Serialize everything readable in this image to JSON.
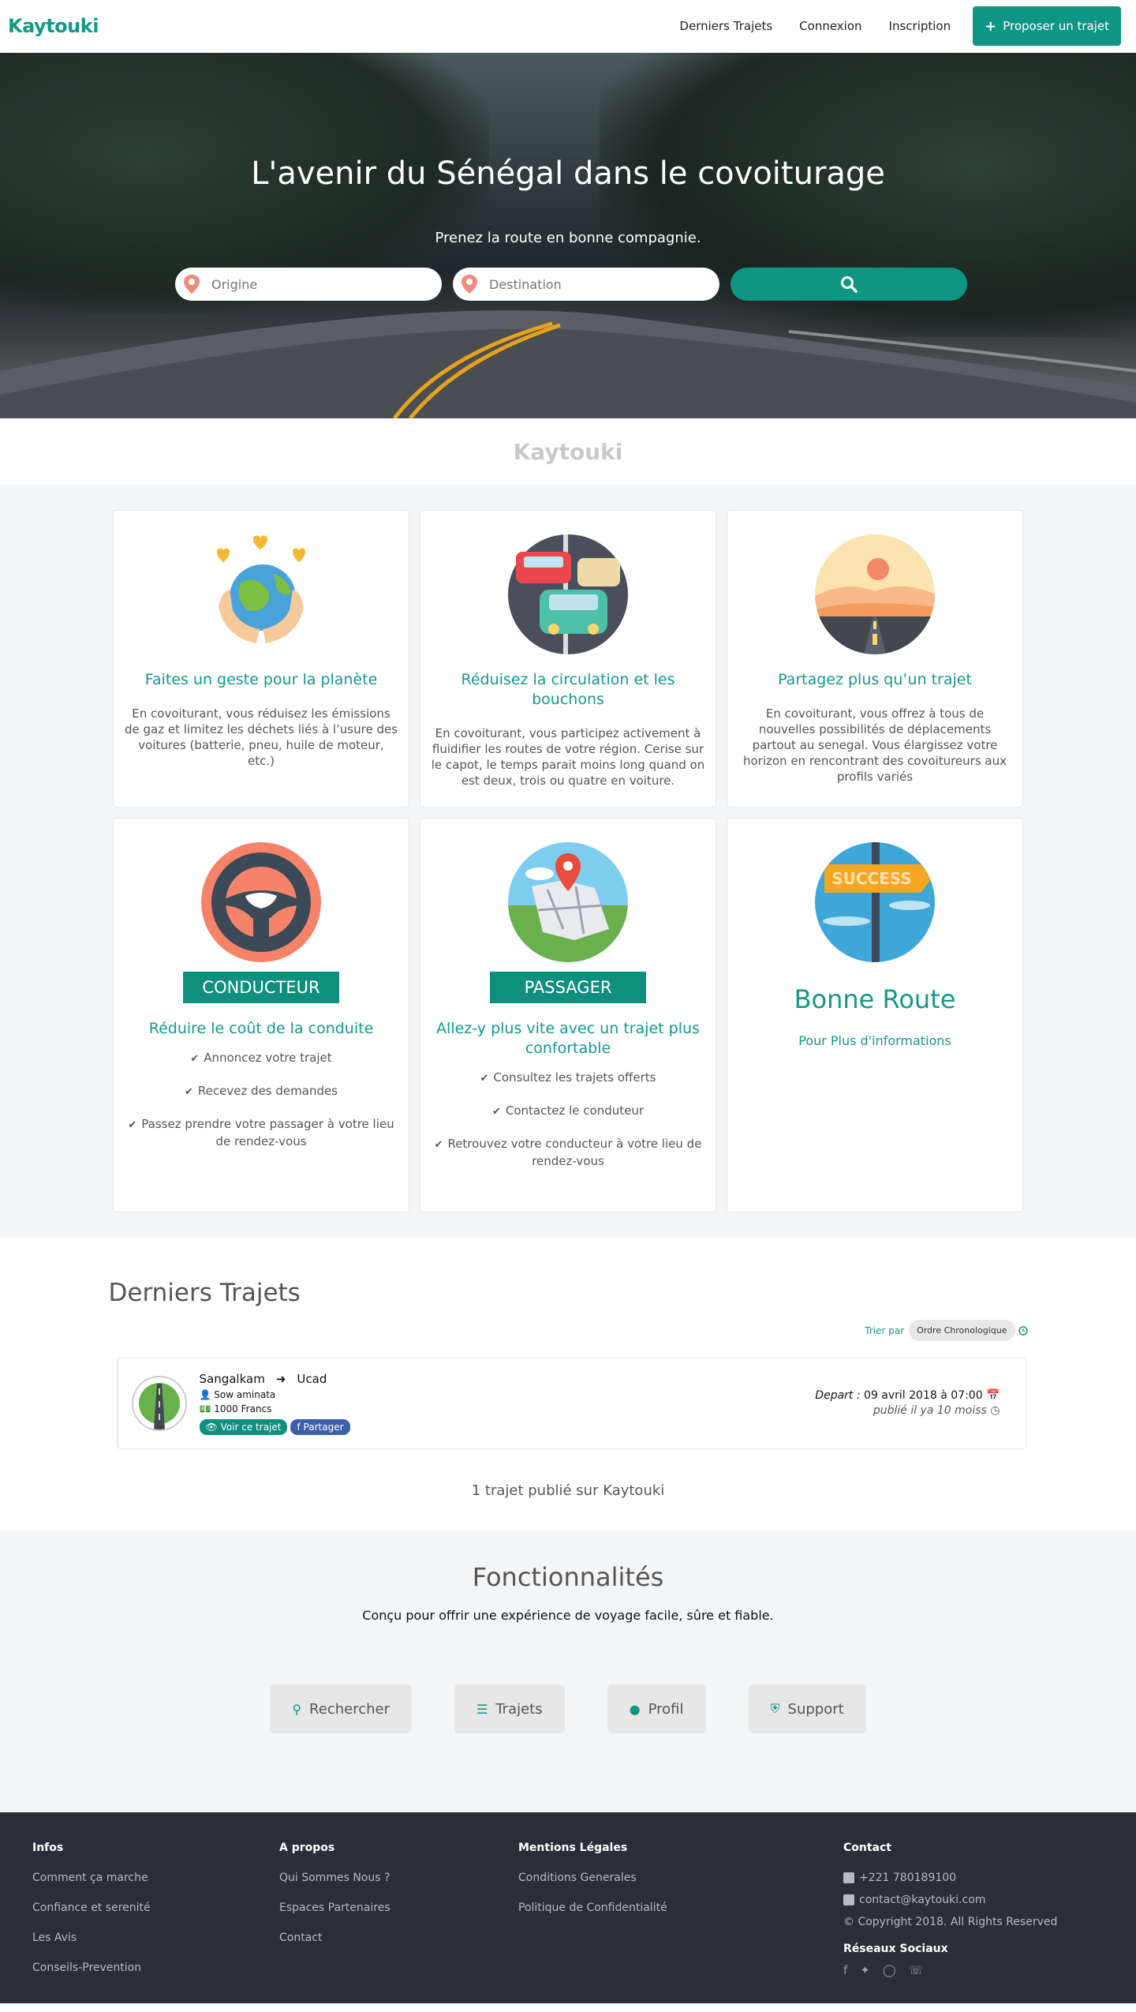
{
  "nav": {
    "brand": "Kaytouki",
    "links": [
      "Derniers Trajets",
      "Connexion",
      "Inscription"
    ],
    "cta": "Proposer un trajet"
  },
  "hero": {
    "title": "L'avenir du Sénégal dans le covoiturage",
    "subtitle": "Prenez la route en bonne compagnie.",
    "origin_placeholder": "Origine",
    "destination_placeholder": "Destination"
  },
  "brand_strip": "Kaytouki",
  "features": [
    {
      "title": "Faites un geste pour la planète",
      "text": "En covoiturant, vous réduisez les émissions de gaz et limitez les déchets liés à l’usure des voitures (batterie, pneu, huile de moteur, etc.)"
    },
    {
      "title": "Réduisez la circulation et les bouchons",
      "text": "En covoiturant, vous participez activement à fluidifier les routes de votre région. Cerise sur le capot, le temps parait moins long quand on est deux, trois ou quatre en voiture."
    },
    {
      "title": "Partagez plus qu’un trajet",
      "text": "En covoiturant, vous offrez à tous de nouvelles possibilités de déplacements partout au senegal. Vous élargissez votre horizon en rencontrant des covoitureurs aux profils variés"
    }
  ],
  "roles": {
    "driver": {
      "badge": "CONDUCTEUR",
      "title": "Réduire le coût de la conduite",
      "items": [
        "Annoncez votre trajet",
        "Recevez des demandes",
        "Passez prendre votre passager à votre lieu de rendez-vous"
      ]
    },
    "passenger": {
      "badge": "PASSAGER",
      "title": "Allez-y plus vite avec un trajet plus confortable",
      "items": [
        "Consultez les trajets offerts",
        "Contactez le conduteur",
        "Retrouvez votre conducteur à votre lieu de rendez-vous"
      ]
    },
    "success": {
      "sign": "SUCCESS",
      "title": "Bonne Route",
      "link": "Pour Plus d'informations"
    }
  },
  "trips": {
    "heading": "Derniers Trajets",
    "sort_label": "Trier par",
    "sort_value": "Ordre Chronologique",
    "items": [
      {
        "from": "Sangalkam",
        "to": "Ucad",
        "driver": "Sow aminata",
        "price": "1000 Francs",
        "view": "Voir ce trajet",
        "share": "Partager",
        "depart_label": "Depart :",
        "depart": "09 avril 2018 à 07:00",
        "published": "publié il ya 10 moiss"
      }
    ],
    "count_line": "1 trajet publié sur Kaytouki"
  },
  "funcs": {
    "heading": "Fonctionnalités",
    "subtitle": "Conçu pour offrir une expérience de voyage facile, sûre et fiable.",
    "buttons": [
      "Rechercher",
      "Trajets",
      "Profil",
      "Support"
    ]
  },
  "footer": {
    "infos": {
      "title": "Infos",
      "links": [
        "Comment ça marche",
        "Confiance et serenité",
        "Les Avis",
        "Conseils-Prevention"
      ]
    },
    "apropos": {
      "title": "A propos",
      "links": [
        "Qui Sommes Nous ?",
        "Espaces Partenaires",
        "Contact"
      ]
    },
    "legal": {
      "title": "Mentions Légales",
      "links": [
        "Conditions Generales",
        "Politique de Confidentialité"
      ]
    },
    "contact": {
      "title": "Contact",
      "phone": "+221 780189100",
      "email": "contact@kaytouki.com",
      "copyright": "© Copyright 2018. All Rights Reserved",
      "social_title": "Réseaux Sociaux"
    }
  },
  "colors": {
    "accent": "#0f9584",
    "footer_bg": "#2b2e34",
    "share": "#3b5fa8"
  }
}
